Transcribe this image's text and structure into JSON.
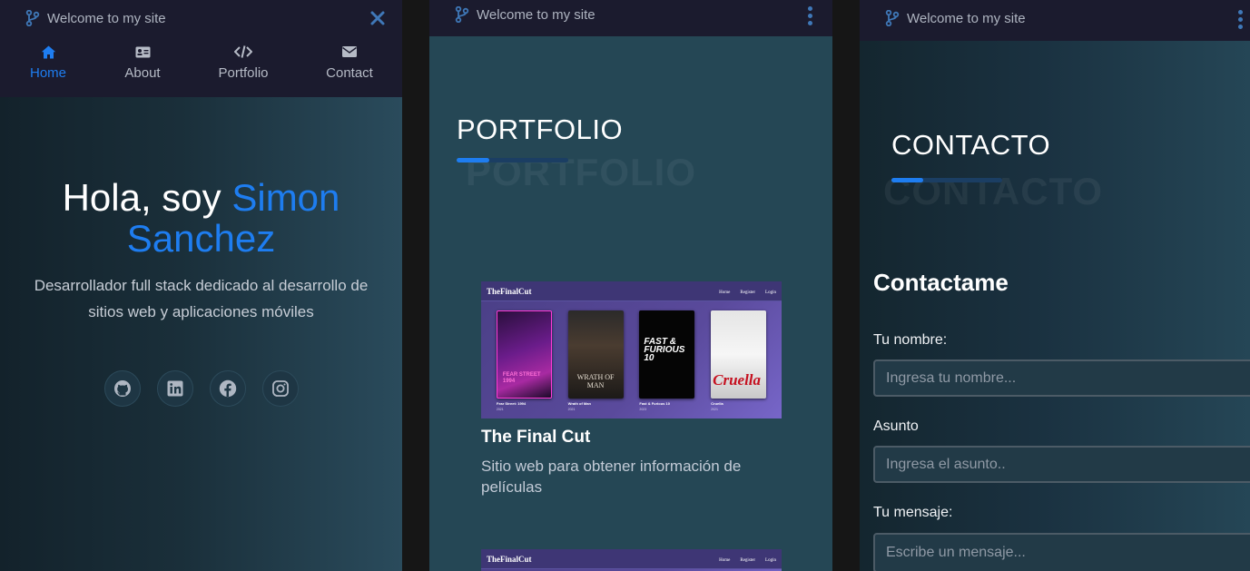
{
  "site_title": "Welcome to my site",
  "nav": [
    {
      "label": "Home",
      "icon": "home-icon",
      "active": true
    },
    {
      "label": "About",
      "icon": "id-card-icon",
      "active": false
    },
    {
      "label": "Portfolio",
      "icon": "code-icon",
      "active": false
    },
    {
      "label": "Contact",
      "icon": "envelope-icon",
      "active": false
    }
  ],
  "hero": {
    "greeting": "Hola, soy ",
    "name_line1": "Simon",
    "name_line2": "Sanchez",
    "description": "Desarrollador full stack dedicado al desarrollo de sitios web y aplicaciones móviles"
  },
  "socials": [
    "github-icon",
    "linkedin-icon",
    "facebook-icon",
    "instagram-icon"
  ],
  "portfolio": {
    "section_title": "PORTFOLIO",
    "section_shadow": "PORTFOLIO",
    "screenshot": {
      "brand": "TheFinalCut",
      "links": [
        "Home",
        "Register",
        "Login"
      ],
      "movies": [
        {
          "title": "Fear Street: 1994",
          "year": "2021"
        },
        {
          "title": "Wrath of Man",
          "year": "2021"
        },
        {
          "title": "Fast & Furious 10",
          "year": "2023"
        },
        {
          "title": "Cruella",
          "year": "2021"
        }
      ],
      "poster_texts": [
        "FEAR STREET 1994",
        "WRATH OF MAN",
        "FAST & FURIOUS 10",
        "Cruella"
      ]
    },
    "project_title": "The Final Cut",
    "project_desc": "Sitio web para obtener información de películas"
  },
  "contact": {
    "section_title": "CONTACTO",
    "section_shadow": "CONTACTO",
    "form_heading": "Contactame",
    "name_label": "Tu nombre:",
    "name_placeholder": "Ingresa tu nombre...",
    "subject_label": "Asunto",
    "subject_placeholder": "Ingresa el asunto..",
    "message_label": "Tu mensaje:",
    "message_placeholder": "Escribe un mensaje..."
  },
  "colors": {
    "accent": "#1e7df0",
    "topbar": "#1b1b2e"
  }
}
